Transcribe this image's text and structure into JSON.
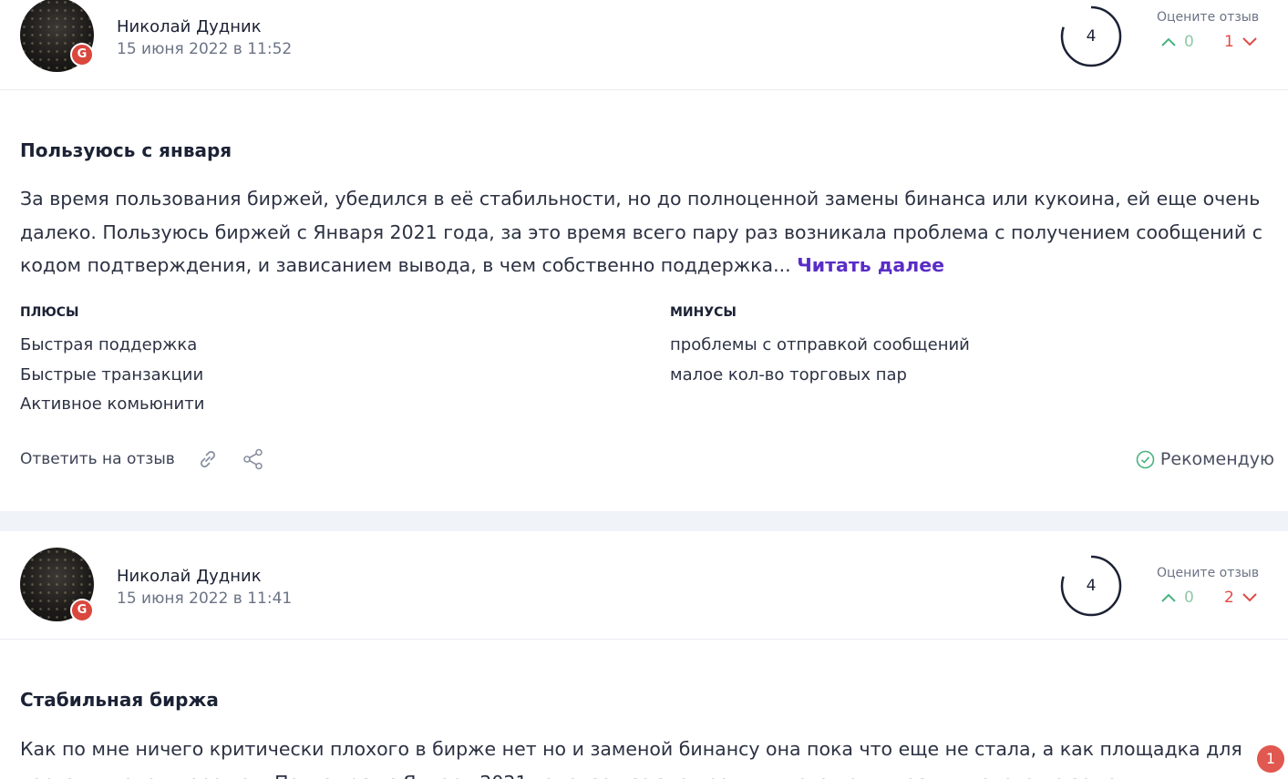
{
  "reviews": [
    {
      "author": "Николай Дудник",
      "date": "15 июня 2022 в 11:52",
      "badge": "G",
      "rating": "4",
      "vote_prompt": "Оцените отзыв",
      "upvotes": "0",
      "downvotes": "1",
      "title": "Пользуюсь с января",
      "text": "За время пользования биржей, убедился в её стабильности, но до полноценной замены бинанса или кукоина, ей еще очень далеко. Пользуюсь биржей с Января 2021 года, за это время всего пару раз возникала проблема с получением сообщений с кодом подтверждения, и зависанием вывода, в чем собственно поддержка...",
      "read_more": "Читать далее",
      "pros_title": "ПЛЮСЫ",
      "pros": [
        "Быстрая поддержка",
        "Быстрые транзакции",
        "Активное комьюнити"
      ],
      "cons_title": "МИНУСЫ",
      "cons": [
        "проблемы с отправкой сообщений",
        "малое кол-во торговых пар"
      ],
      "reply_label": "Ответить на отзыв",
      "recommend_label": "Рекомендую"
    },
    {
      "author": "Николай Дудник",
      "date": "15 июня 2022 в 11:41",
      "badge": "G",
      "rating": "4",
      "vote_prompt": "Оцените отзыв",
      "upvotes": "0",
      "downvotes": "2",
      "title": "Стабильная биржа",
      "text": "Как по мне ничего критически плохого в бирже нет но и заменой бинансу она пока что еще не стала, а как площадка для торгов в целом хорошая. Пользуюсь с Января 2021 года, за все это время ничего критически плохого не заметил"
    }
  ],
  "notification_count": "1",
  "colors": {
    "accent": "#5a2dc7",
    "upvote": "#49b37e",
    "downvote": "#df4a45",
    "rating_ring": "#1c2235",
    "recommend": "#49b37e",
    "badge": "#d9473d"
  }
}
